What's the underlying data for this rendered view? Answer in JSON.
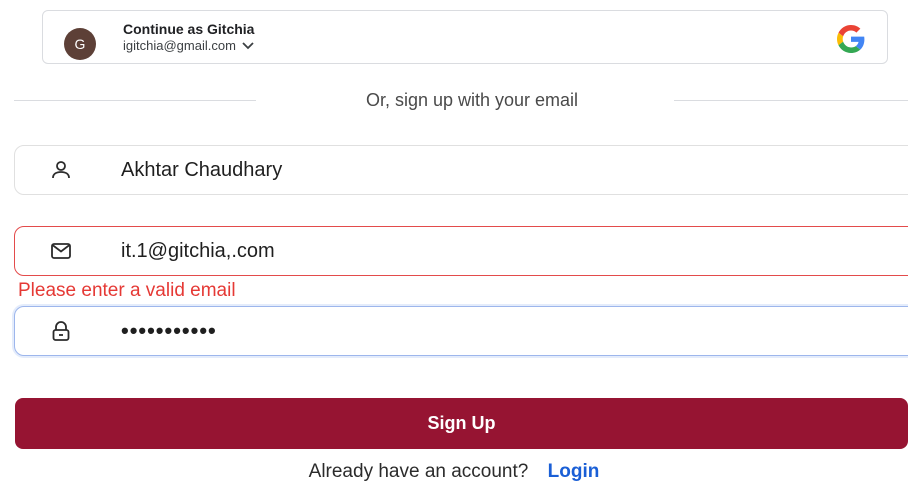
{
  "google": {
    "avatar_initial": "G",
    "title": "Continue as Gitchia",
    "email": "igitchia@gmail.com",
    "logo_icon": "google-icon"
  },
  "divider": {
    "text": "Or, sign up with your email"
  },
  "form": {
    "name": {
      "value": "Akhtar Chaudhary",
      "icon": "user-icon"
    },
    "email": {
      "value": "it.1@gitchia,.com",
      "icon": "mail-icon",
      "error": "Please enter a valid email"
    },
    "password": {
      "masked_value": "•••••••••••",
      "icon": "lock-icon"
    },
    "submit_label": "Sign Up"
  },
  "footer": {
    "prompt": "Already have an account?",
    "login_label": "Login"
  },
  "colors": {
    "primary": "#961432",
    "error": "#e53935",
    "link": "#1a5fd6",
    "focus": "#9db6ec"
  }
}
